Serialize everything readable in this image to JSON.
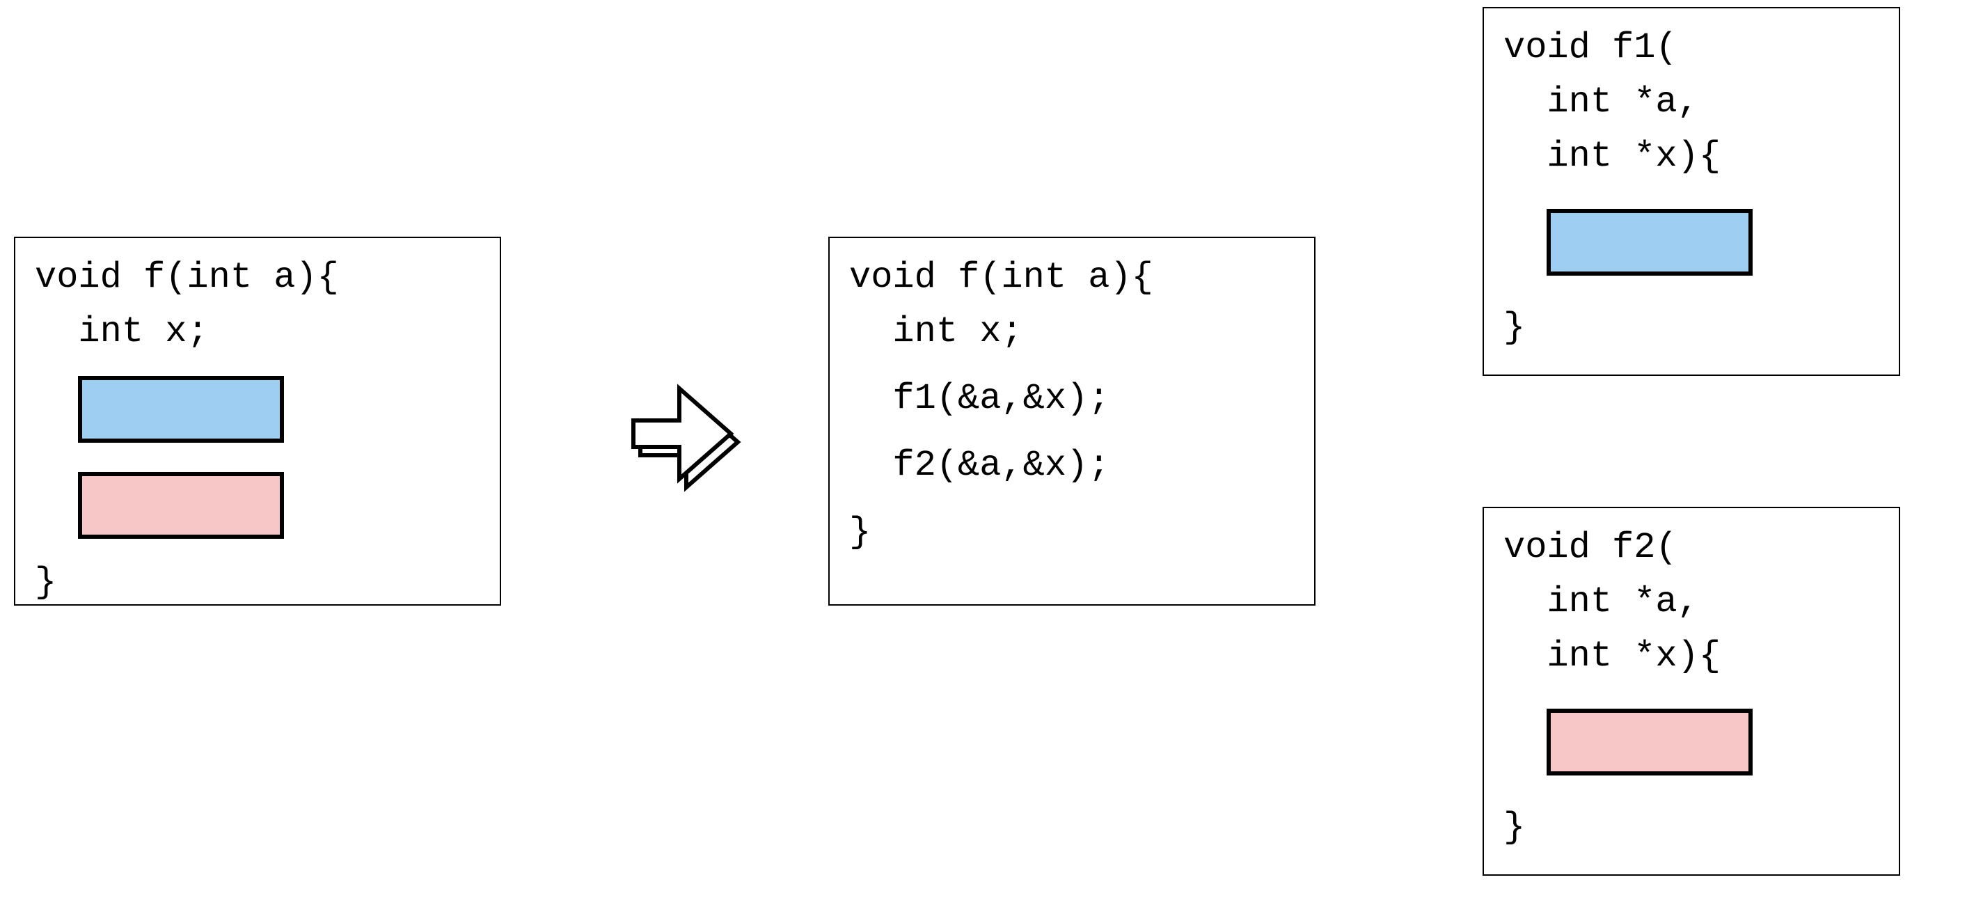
{
  "colors": {
    "blue": "#9ecff2",
    "pink": "#f7c6c6"
  },
  "left_panel": {
    "line1": "void f(int a){",
    "line2": "  int x;",
    "close": "}"
  },
  "mid_panel": {
    "line1": "void f(int a){",
    "line2": "  int x;",
    "line3": "  f1(&a,&x);",
    "line4": "  f2(&a,&x);",
    "close": "}"
  },
  "f1_panel": {
    "line1": "void f1(",
    "line2": "  int *a,",
    "line3": "  int *x){",
    "close": "}"
  },
  "f2_panel": {
    "line1": "void f2(",
    "line2": "  int *a,",
    "line3": "  int *x){",
    "close": "}"
  }
}
